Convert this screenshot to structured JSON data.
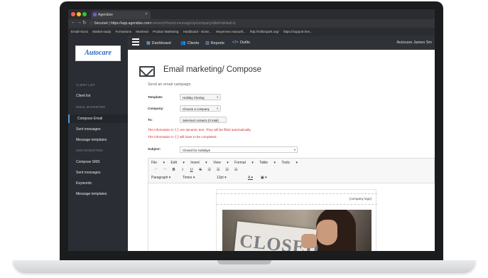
{
  "browser": {
    "tab_title": "Agendize",
    "url_secure": "Sécurisé",
    "url_main": "https://app.agendize.com",
    "url_path": "/connect/#/send-message/sp/company/d&id=default-d",
    "bookmarks": [
      "Email+Docs",
      "Market study",
      "Formations",
      "Montreal",
      "Product Marketing",
      "Hardboard - storie...",
      "Moyennes manuell...",
      "http://millonpark.org/",
      "https://support.hes..."
    ]
  },
  "sidebar": {
    "logo_text": "Autocare",
    "client_heading": "CLIENT LIST",
    "client_list": "Client list",
    "email_heading": "EMAIL MARKETING",
    "compose_email": "Compose Email",
    "sent_messages_email": "Sent messages",
    "message_templates_email": "Message templates",
    "sms_heading": "SMS MARKETING",
    "compose_sms": "Compose SMS",
    "sent_messages_sms": "Sent messages",
    "keywords": "Keywords",
    "message_templates_sms": "Message templates"
  },
  "topnav": {
    "dashboard": "Dashboard",
    "clients": "Clients",
    "reports": "Reports",
    "outils": "Outils",
    "user": "Autocare James Sm"
  },
  "page": {
    "title": "Email marketing/ Compose",
    "subtitle": "Send an email campaign",
    "template_label": "Template:",
    "template_value": "Holiday Closing",
    "company_label": "Company:",
    "company_value": "Choose a company",
    "to_label": "To:",
    "to_value": "Selected contacts (0 total)",
    "dynamic_note": "The information in '{ }' are dynamic text. They will be filled automatically.",
    "complete_note": "The information in '[ ]' will have to be completed.",
    "subject_label": "Subject:",
    "subject_value": "Closed for Holidays"
  },
  "editor": {
    "menu": [
      "File",
      "Edit",
      "Insert",
      "View",
      "Format",
      "Table",
      "Tools"
    ],
    "format_block": "Paragraph",
    "font_family": "Times",
    "font_size": "12pt",
    "company_logo_placeholder": "{company logo}",
    "photo_sign_text": "CLOSED"
  }
}
